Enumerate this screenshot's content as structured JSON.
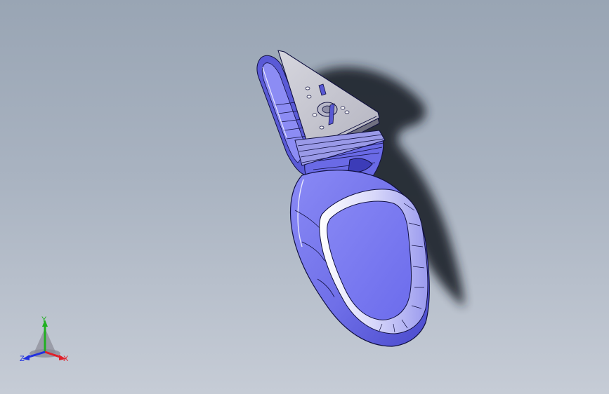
{
  "viewport": {
    "background_top": "#99a5b4",
    "background_bottom": "#c6ccd6"
  },
  "model": {
    "body_color": "#7c7cf0",
    "body_dark": "#4646c8",
    "edge_color": "#101040",
    "plate_color": "#c9c9d3",
    "shadow_color": "#1e222a"
  },
  "triad": {
    "x_label": "X",
    "y_label": "Y",
    "z_label": "Z",
    "x_color": "#e0202a",
    "y_color": "#20b020",
    "z_color": "#2030e0"
  }
}
